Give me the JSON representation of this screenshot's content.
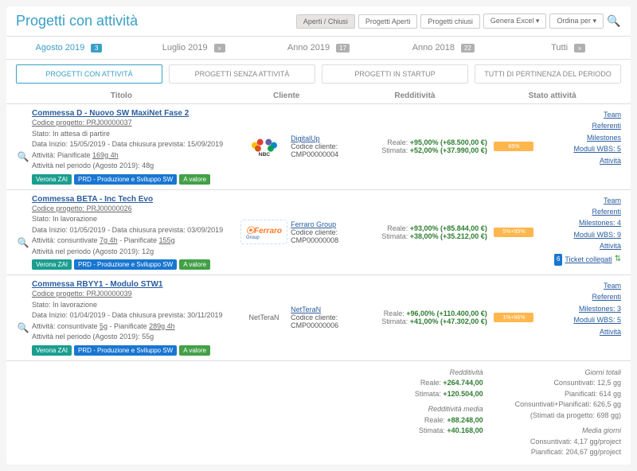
{
  "header": {
    "title": "Progetti con attività",
    "buttons": {
      "aperti_chiusi": "Aperti / Chiusi",
      "progetti_aperti": "Progetti Aperti",
      "progetti_chiusi": "Progetti chiusi",
      "genera_excel": "Genera Excel ▾",
      "ordina_per": "Ordina per ▾"
    }
  },
  "periods": {
    "agosto": "Agosto 2019",
    "agosto_badge": "3",
    "luglio": "Luglio 2019",
    "luglio_badge": "»",
    "anno2019": "Anno 2019",
    "anno2019_badge": "17",
    "anno2018": "Anno 2018",
    "anno2018_badge": "22",
    "tutti": "Tutti",
    "tutti_badge": "»"
  },
  "filters": {
    "con": "PROGETTI CON ATTIVITÀ",
    "senza": "PROGETTI SENZA ATTIVITÀ",
    "startup": "PROGETTI IN STARTUP",
    "tutti": "TUTTI DI PERTINENZA DEL PERIODO"
  },
  "columns": {
    "titolo": "Titolo",
    "cliente": "Cliente",
    "redditivita": "Redditività",
    "stato": "Stato attività"
  },
  "projects": [
    {
      "name": "Commessa D - Nuovo SW MaxiNet Fase 2",
      "code": "Codice progetto: PRJ00000037",
      "stato": "Stato: In attesa di partire",
      "dates": "Data Inizio: 15/05/2019 - Data chiusura prevista: 15/09/2019",
      "attivita": "Attività: Pianificate ",
      "att_ul": "169g 4h",
      "periodo": "Attività nel periodo (Agosto 2019): 48g",
      "tag1": "Verona ZAI",
      "tag2": "PRD - Produzione e Sviluppo SW",
      "tag3": "A valore",
      "logo": "NBC",
      "client": "DigitalUp",
      "client_code": "Codice cliente:",
      "client_cmp": "CMP00000004",
      "reale_label": "Reale:",
      "reale": "+95,00% (+68.500,00 €)",
      "stimata_label": "Stimata:",
      "stimata": "+52,00% (+37.990,00 €)",
      "progress": "85%",
      "links": {
        "team": "Team",
        "ref": "Referenti",
        "mil": "Milestones",
        "wbs": "Moduli WBS: 5",
        "att": "Attività"
      }
    },
    {
      "name": "Commessa BETA - Inc Tech Evo",
      "code": "Codice progetto: PRJ00000026",
      "stato": "Stato: In lavorazione",
      "dates": "Data Inizio: 01/05/2019 - Data chiusura prevista: 03/09/2019",
      "attivita": "Attività: consuntivate ",
      "att_ul": "7g 4h",
      "att2": " - Pianificate ",
      "att_ul2": "155g",
      "periodo": "Attività nel periodo (Agosto 2019): 12g",
      "tag1": "Verona ZAI",
      "tag2": "PRD - Produzione e Sviluppo SW",
      "tag3": "A valore",
      "logo": "ferraro",
      "client": "Ferraro Group",
      "client_code": "Codice cliente:",
      "client_cmp": "CMP00000008",
      "reale_label": "Reale:",
      "reale": "+93,00% (+85.844,00 €)",
      "stimata_label": "Stimata:",
      "stimata": "+38,00% (+35.212,00 €)",
      "progress": "5%+95%",
      "links": {
        "team": "Team",
        "ref": "Referenti",
        "mil": "Milestones: 4",
        "wbs": "Moduli WBS: 9",
        "att": "Attività"
      },
      "ticket_badge": "6",
      "ticket": "Ticket collegati"
    },
    {
      "name": "Commessa RBYY1 - Modulo STW1",
      "code": "Codice progetto: PRJ00000039",
      "stato": "Stato: In lavorazione",
      "dates": "Data Inizio: 01/04/2019 - Data chiusura prevista: 30/11/2019",
      "attivita": "Attività: consuntivate ",
      "att_ul": "5g",
      "att2": " - Pianificate ",
      "att_ul2": "289g 4h",
      "periodo": "Attività nel periodo (Agosto 2019): 55g",
      "tag1": "Verona ZAI",
      "tag2": "PRD - Produzione e Sviluppo SW",
      "tag3": "A valore",
      "logo": "NetTeraN",
      "client": "NetTeraN",
      "client_code": "Codice cliente:",
      "client_cmp": "CMP00000006",
      "reale_label": "Reale:",
      "reale": "+96,00% (+110.400,00 €)",
      "stimata_label": "Stimata:",
      "stimata": "+41,00% (+47.302,00 €)",
      "progress": "1%+86%",
      "links": {
        "team": "Team",
        "ref": "Referenti",
        "mil": "Milestones: 3",
        "wbs": "Moduli WBS: 5",
        "att": "Attività"
      }
    }
  ],
  "summary": {
    "red_title": "Redditività",
    "red_reale_l": "Reale:",
    "red_reale": "+264.744,00",
    "red_stim_l": "Stimata:",
    "red_stim": "+120.504,00",
    "redm_title": "Redditività media",
    "redm_reale_l": "Reale:",
    "redm_reale": "+88.248,00",
    "redm_stim_l": "Stimata:",
    "redm_stim": "+40.168,00",
    "gt_title": "Giorni totali",
    "gt1": "Consuntivati: 12,5 gg",
    "gt2": "Pianificati: 614 gg",
    "gt3": "Consuntivati+Pianificati: 626,5 gg",
    "gt4": "(Stimati da progetto: 698 gg)",
    "mg_title": "Media giorni",
    "mg1": "Consuntivati: 4,17 gg/project",
    "mg2": "Pianificati: 204,67 gg/project"
  }
}
